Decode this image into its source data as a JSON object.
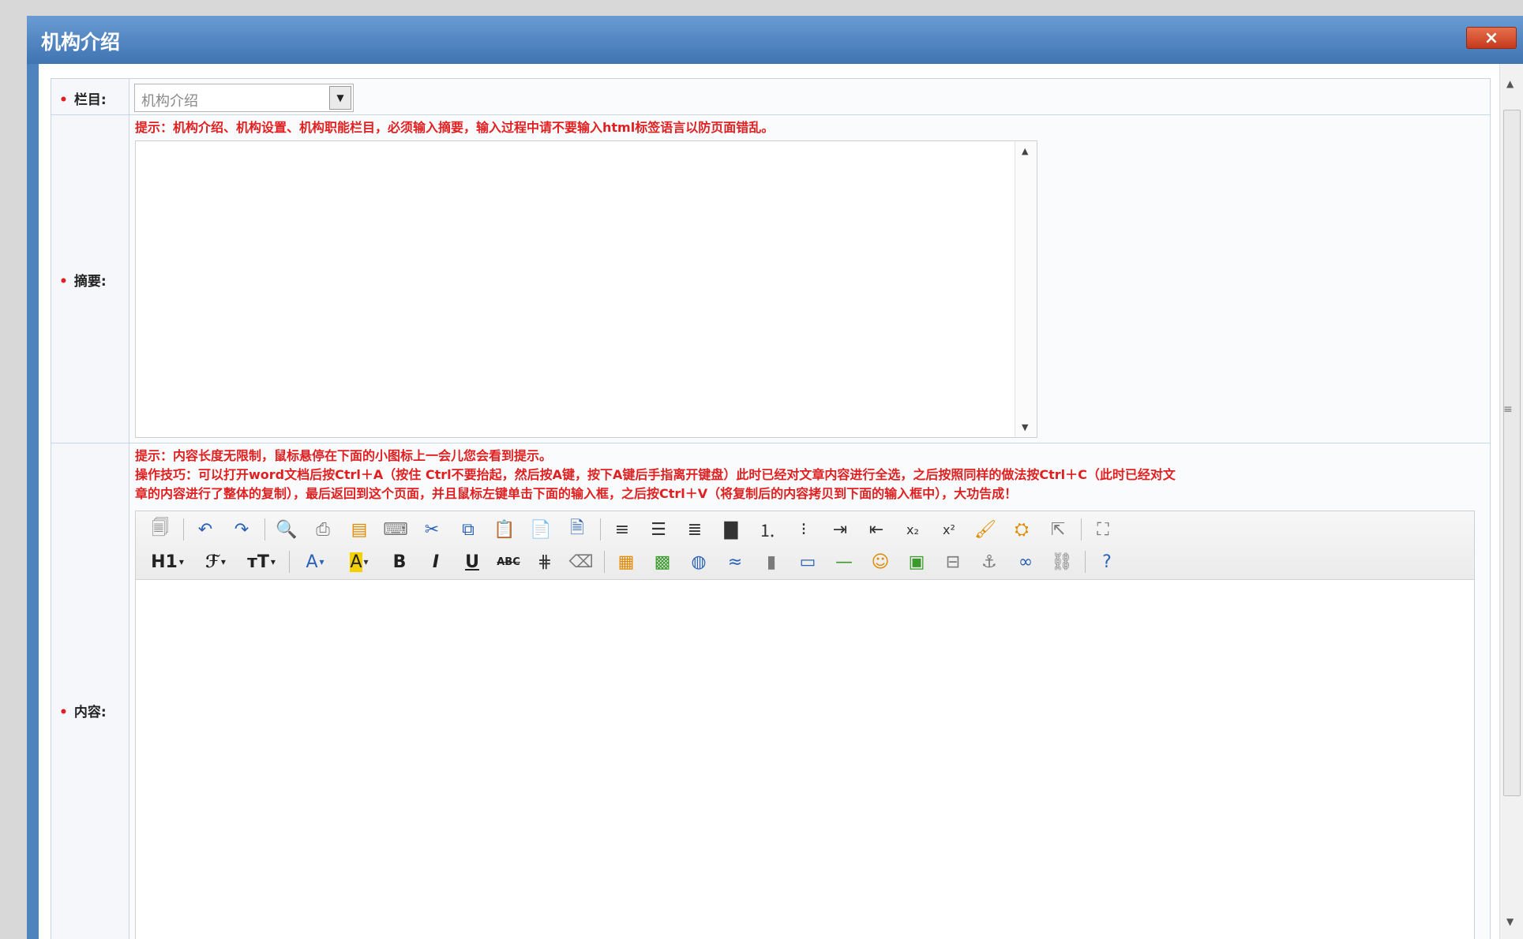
{
  "window": {
    "title": "机构介绍",
    "close_label": "×"
  },
  "form": {
    "column": {
      "required_mark": "•",
      "label": "栏目:",
      "select_value": "机构介绍"
    },
    "summary": {
      "required_mark": "•",
      "label": "摘要:",
      "hint": "提示：机构介绍、机构设置、机构职能栏目，必须输入摘要，输入过程中请不要输入html标签语言以防页面错乱。"
    },
    "content": {
      "required_mark": "•",
      "label": "内容:",
      "hint_lines": [
        "提示：内容长度无限制，鼠标悬停在下面的小图标上一会儿您会看到提示。",
        "操作技巧：可以打开word文档后按Ctrl＋A（按住 Ctrl不要抬起，然后按A键，按下A键后手指离开键盘）此时已经对文章内容进行全选，之后按照同样的做法按Ctrl＋C（此时已经对文",
        "章的内容进行了整体的复制），最后返回到这个页面，并且鼠标左键单击下面的输入框，之后按Ctrl＋V（将复制后的内容拷贝到下面的输入框中），大功告成！"
      ],
      "toolbar": {
        "heading": "H1",
        "font_family": "ℱ",
        "font_size": "тT",
        "font_color": "A",
        "highlight": "A",
        "bold": "B",
        "italic": "I",
        "underline": "U",
        "strikethrough": "ABC"
      }
    }
  },
  "colors": {
    "title_bar": "#4f83bd",
    "hint_text": "#e02020",
    "required_mark": "#e02020"
  }
}
